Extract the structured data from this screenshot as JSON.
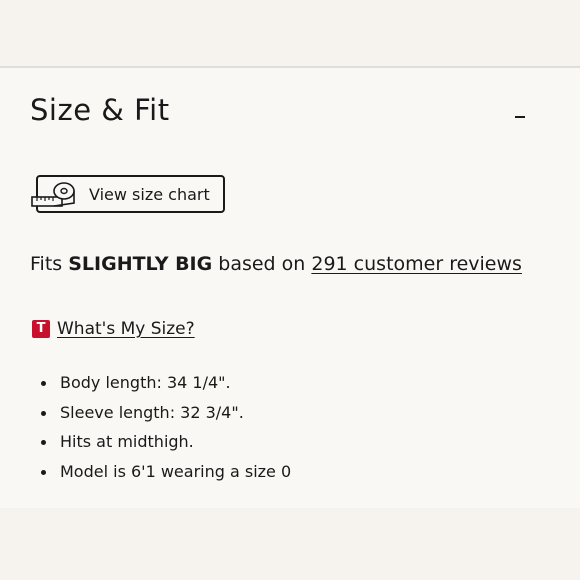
{
  "section": {
    "title": "Size & Fit",
    "toggle_symbol": "–"
  },
  "size_chart_button": {
    "label": "View size chart",
    "icon": "measuring-tape-icon"
  },
  "fit": {
    "prefix": "Fits",
    "verdict": "SLIGHTLY BIG",
    "middle": "based on",
    "reviews_link": "291 customer reviews"
  },
  "whats_my_size": {
    "badge": "T",
    "label": "What's My Size?",
    "badge_color": "#c8102e"
  },
  "details": [
    "Body length: 34 1/4\".",
    "Sleeve length: 32 3/4\".",
    "Hits at midthigh.",
    "Model is 6'1 wearing a size 0"
  ]
}
